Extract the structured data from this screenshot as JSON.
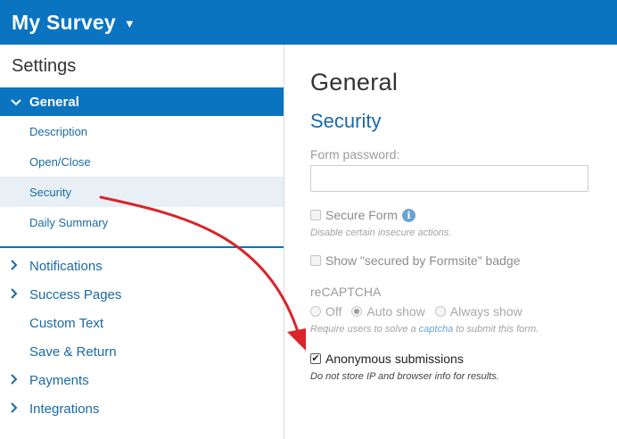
{
  "header": {
    "title": "My Survey",
    "caret_icon": "caret-down-icon"
  },
  "sidebar": {
    "heading": "Settings",
    "general": {
      "label": "General",
      "icon": "chevron-down-icon"
    },
    "sub_items": [
      {
        "label": "Description"
      },
      {
        "label": "Open/Close"
      },
      {
        "label": "Security",
        "active": true
      },
      {
        "label": "Daily Summary"
      }
    ],
    "main_items": [
      {
        "label": "Notifications",
        "chevron": true
      },
      {
        "label": "Success Pages",
        "chevron": true
      },
      {
        "label": "Custom Text",
        "chevron": false
      },
      {
        "label": "Save & Return",
        "chevron": false
      },
      {
        "label": "Payments",
        "chevron": true
      },
      {
        "label": "Integrations",
        "chevron": true
      }
    ]
  },
  "main": {
    "page_title": "General",
    "section_title": "Security",
    "form_password": {
      "label": "Form password:",
      "value": ""
    },
    "secure_form": {
      "label": "Secure Form",
      "checked": false,
      "hint": "Disable certain insecure actions."
    },
    "secured_badge": {
      "label": "Show \"secured by Formsite\" badge",
      "checked": false
    },
    "recaptcha": {
      "label": "reCAPTCHA",
      "options": [
        "Off",
        "Auto show",
        "Always show"
      ],
      "selected": "Auto show",
      "hint_before": "Require users to solve a ",
      "hint_link": "captcha",
      "hint_after": " to submit this form."
    },
    "anonymous": {
      "label": "Anonymous submissions",
      "checked": true,
      "hint": "Do not store IP and browser info for results."
    }
  },
  "colors": {
    "brand": "#0a74c0",
    "link": "#1a6aa6",
    "annotation_arrow": "#d9252a"
  }
}
